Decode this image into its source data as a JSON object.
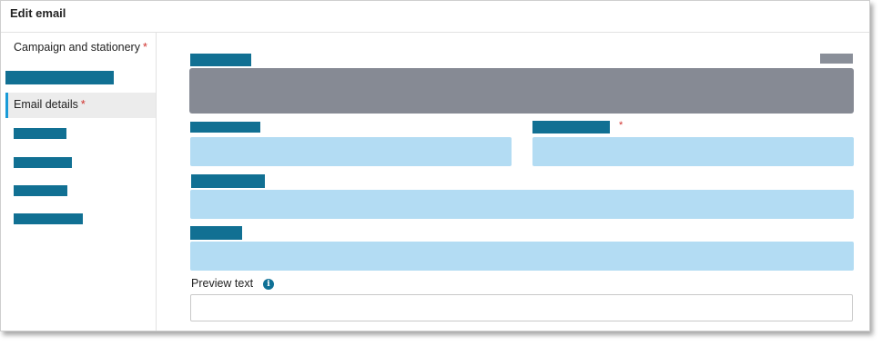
{
  "header": {
    "title": "Edit email"
  },
  "sidebar": {
    "items": [
      {
        "label": "Campaign and stationery",
        "required": "*"
      },
      {
        "label": "Email details",
        "required": "*"
      }
    ]
  },
  "form": {
    "second_row_required": "*",
    "preview_text_label": "Preview text",
    "preview_text_value": "",
    "info_icon": "info-icon"
  },
  "colors": {
    "accent": "#1a9bd7",
    "redaction": "#117093",
    "field": "#b3dcf3",
    "required": "#d0312d"
  }
}
